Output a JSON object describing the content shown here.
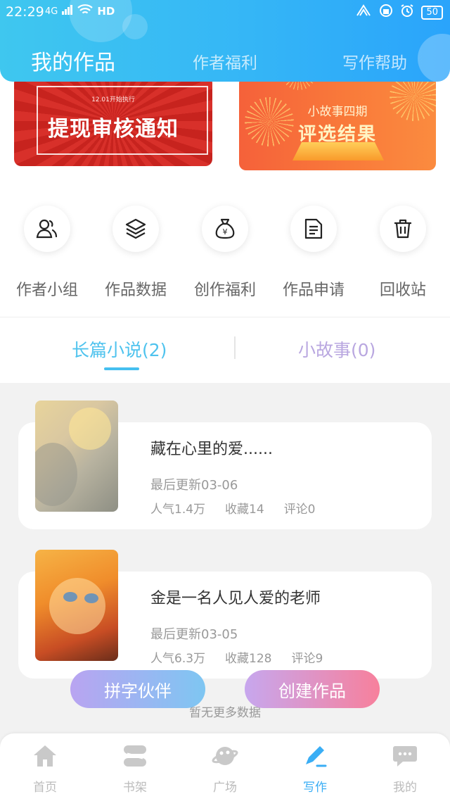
{
  "status_bar": {
    "time": "22:29",
    "network": "4G",
    "hd": "HD",
    "battery": "50"
  },
  "header": {
    "tabs": [
      {
        "label": "我的作品",
        "active": true
      },
      {
        "label": "作者福利",
        "active": false
      },
      {
        "label": "写作帮助",
        "active": false
      }
    ]
  },
  "banners": [
    {
      "small": "12.01开始执行",
      "title": "提现审核通知"
    },
    {
      "small": "小故事四期",
      "title": "评选结果"
    }
  ],
  "quick_actions": [
    {
      "label": "作者小组",
      "icon": "people-icon"
    },
    {
      "label": "作品数据",
      "icon": "layers-icon"
    },
    {
      "label": "创作福利",
      "icon": "money-bag-icon"
    },
    {
      "label": "作品申请",
      "icon": "document-icon"
    },
    {
      "label": "回收站",
      "icon": "trash-icon"
    }
  ],
  "segments": {
    "left": "长篇小说(2)",
    "right": "小故事(0)",
    "active": "left"
  },
  "works": [
    {
      "title": "藏在心里的爱......",
      "updated": "最后更新03-06",
      "popularity": "人气1.4万",
      "favorites": "收藏14",
      "comments": "评论0"
    },
    {
      "title": "金是一名人见人爱的老师",
      "updated": "最后更新03-05",
      "popularity": "人气6.3万",
      "favorites": "收藏128",
      "comments": "评论9"
    }
  ],
  "no_more": "暂无更多数据",
  "fabs": {
    "left": "拼字伙伴",
    "right": "创建作品"
  },
  "bottom_nav": [
    {
      "label": "首页",
      "icon": "home-icon",
      "active": false
    },
    {
      "label": "书架",
      "icon": "bookshelf-icon",
      "active": false
    },
    {
      "label": "广场",
      "icon": "planet-icon",
      "active": false
    },
    {
      "label": "写作",
      "icon": "pen-icon",
      "active": true
    },
    {
      "label": "我的",
      "icon": "chat-bubble-icon",
      "active": false
    }
  ],
  "colors": {
    "accent": "#3aaef5",
    "header_start": "#3fc7ef",
    "header_end": "#2aa4fb"
  }
}
